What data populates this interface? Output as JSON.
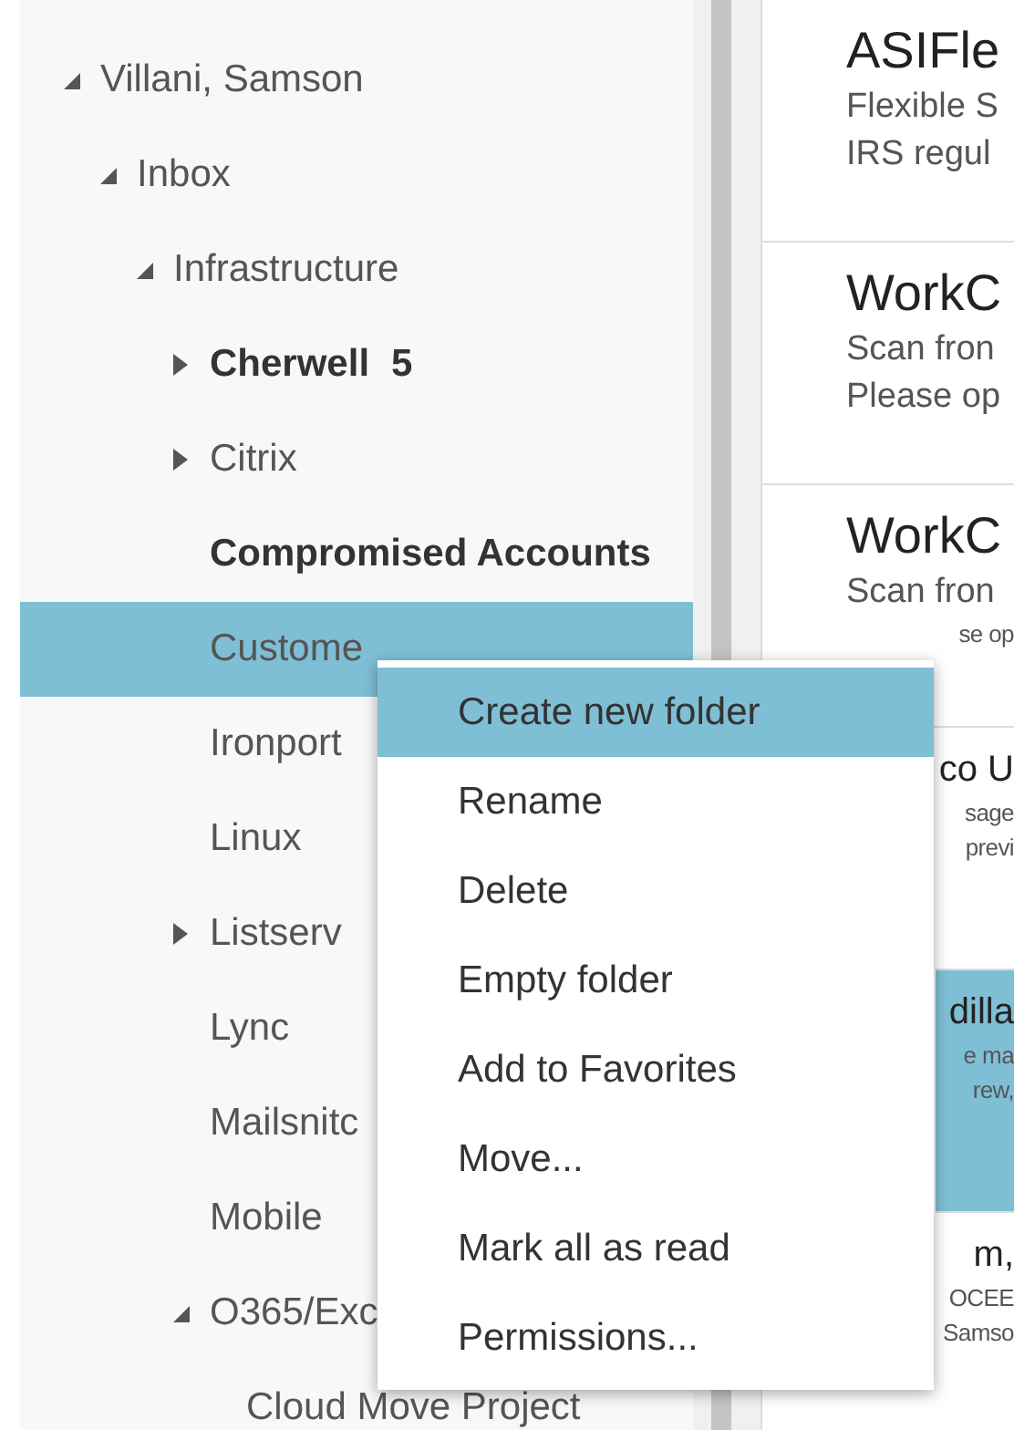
{
  "folder_tree": [
    {
      "label": "Villani, Samson",
      "expanded": true,
      "selected": false,
      "unread": false,
      "children": [
        {
          "label": "Inbox",
          "expanded": true,
          "selected": false,
          "unread": false,
          "children": [
            {
              "label": "Infrastructure",
              "expanded": true,
              "selected": false,
              "unread": false,
              "children": [
                {
                  "label": "Cherwell",
                  "count": "5",
                  "expanded": false,
                  "selected": false,
                  "unread": true
                },
                {
                  "label": "Citrix",
                  "expanded": false,
                  "selected": false,
                  "unread": false
                },
                {
                  "label": "Compromised Accounts",
                  "selected": false,
                  "unread": true
                },
                {
                  "label": "Custome",
                  "selected": true,
                  "unread": false
                },
                {
                  "label": "Ironport",
                  "selected": false,
                  "unread": false
                },
                {
                  "label": "Linux",
                  "selected": false,
                  "unread": false
                },
                {
                  "label": "Listserv",
                  "expanded": false,
                  "selected": false,
                  "unread": false
                },
                {
                  "label": "Lync",
                  "selected": false,
                  "unread": false
                },
                {
                  "label": "Mailsnitc",
                  "selected": false,
                  "unread": false
                },
                {
                  "label": "Mobile",
                  "selected": false,
                  "unread": false
                },
                {
                  "label": "O365/Exc",
                  "expanded": true,
                  "selected": false,
                  "unread": false,
                  "children": [
                    {
                      "label": "Cloud Move Project",
                      "selected": false,
                      "unread": false
                    }
                  ]
                }
              ]
            }
          ]
        }
      ]
    }
  ],
  "messages": [
    {
      "selected": false,
      "sender": {
        "text": "ASIFle",
        "covered": false
      },
      "lines": [
        {
          "text": "Flexible S",
          "covered": false
        },
        {
          "text": "IRS regul",
          "covered": false
        }
      ]
    },
    {
      "selected": false,
      "sender": {
        "text": "WorkC",
        "covered": false
      },
      "lines": [
        {
          "text": "Scan fron",
          "covered": false
        },
        {
          "text": "Please op",
          "covered": false
        }
      ]
    },
    {
      "selected": false,
      "sender": {
        "text": "WorkC",
        "covered": false
      },
      "lines": [
        {
          "text": "Scan fron",
          "covered": false
        },
        {
          "text": "se op",
          "covered": true
        }
      ]
    },
    {
      "selected": false,
      "sender": {
        "text": "co U",
        "covered": true
      },
      "lines": [
        {
          "text": "sage",
          "covered": true
        },
        {
          "text": "previ",
          "covered": true
        }
      ]
    },
    {
      "selected": true,
      "sender": {
        "text": "dilla",
        "covered": true
      },
      "lines": [
        {
          "text": "e ma",
          "covered": true
        },
        {
          "text": "rew,",
          "covered": true
        }
      ]
    },
    {
      "selected": false,
      "sender": {
        "text": "m,",
        "covered": true
      },
      "lines": [
        {
          "text": "OCEE",
          "covered": true
        },
        {
          "text": "Samso",
          "covered": true
        }
      ]
    }
  ],
  "context_menu": [
    {
      "label": "Create new folder",
      "selected": true
    },
    {
      "label": "Rename",
      "selected": false
    },
    {
      "label": "Delete",
      "selected": false
    },
    {
      "label": "Empty folder",
      "selected": false
    },
    {
      "label": "Add to Favorites",
      "selected": false
    },
    {
      "label": "Move...",
      "selected": false
    },
    {
      "label": "Mark all as read",
      "selected": false
    },
    {
      "label": "Permissions...",
      "selected": false
    }
  ]
}
